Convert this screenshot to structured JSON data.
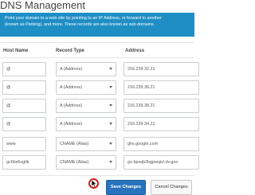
{
  "page": {
    "title": "DNS Management",
    "info_lines": [
      "Point your domain to a web site by pointing to an IP Address, or forward to another",
      "(known as Parking), and more. These records are also known as sub-domains."
    ]
  },
  "table": {
    "headers": {
      "host": "Host Name",
      "type": "Record Type",
      "address": "Address"
    },
    "rows": [
      {
        "host": "@",
        "type": "A (Address)",
        "address": "216.239.32.21"
      },
      {
        "host": "@",
        "type": "A (Address)",
        "address": "216.239.36.21"
      },
      {
        "host": "@",
        "type": "A (Address)",
        "address": "216.239.38.21"
      },
      {
        "host": "@",
        "type": "A (Address)",
        "address": "216.239.34.21"
      },
      {
        "host": "www",
        "type": "CNAME (Alias)",
        "address": "ghs.google.com"
      },
      {
        "host": "gc6bs6xgtik",
        "type": "CNAME (Alias)",
        "address": "gv-bpvqb2bgpwqivl.dv.goo"
      }
    ]
  },
  "actions": {
    "save_label": "Save Changes",
    "cancel_label": "Cancel Changes"
  },
  "colors": {
    "info_bg": "#1f8ec4",
    "save_bg": "#2773bd",
    "cursor_ring": "#cc1f1f"
  }
}
